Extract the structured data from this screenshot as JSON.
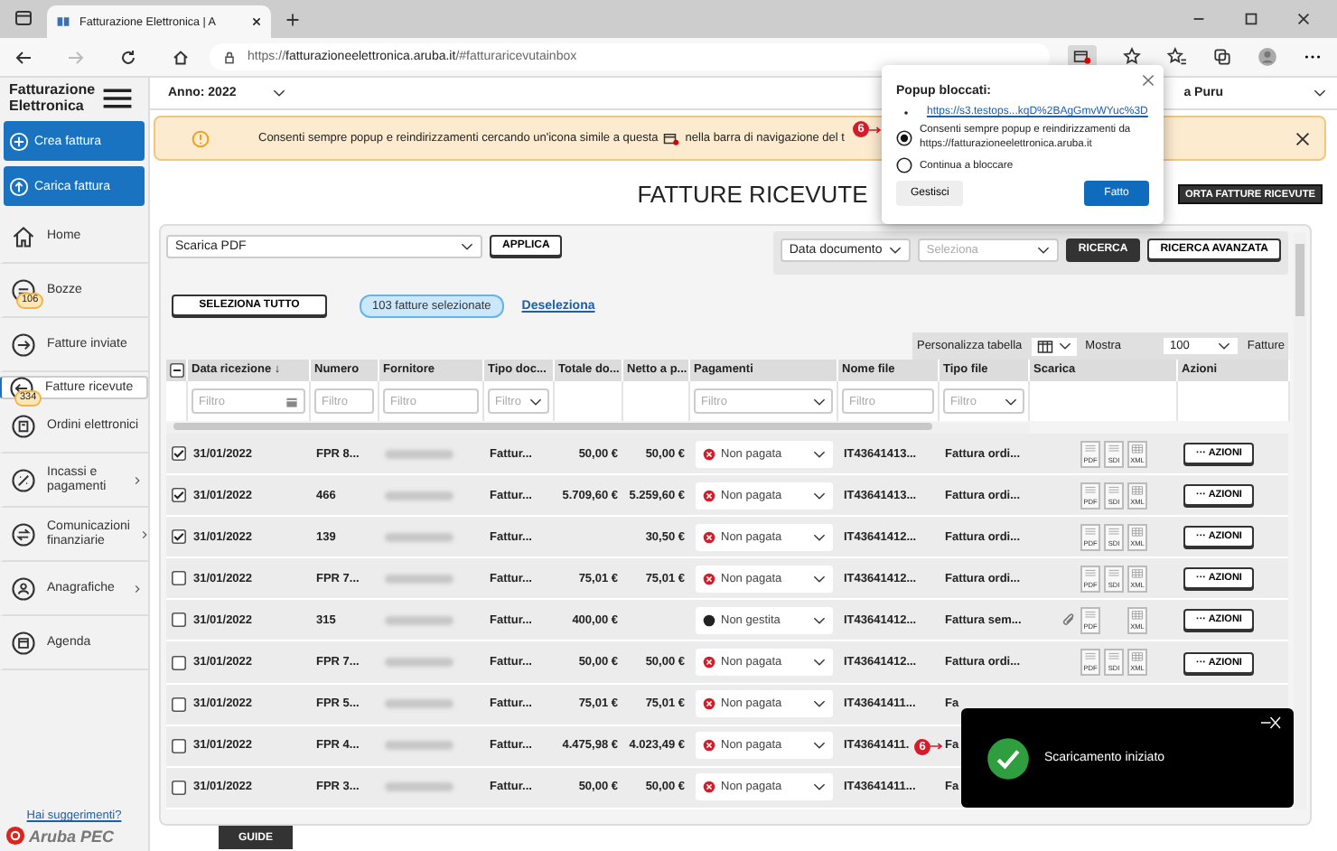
{
  "browser": {
    "tab_title": "Fatturazione Elettronica | A",
    "url_scheme": "https://",
    "url_host": "fatturazioneelettronica.aruba.it",
    "url_path": "/#fatturaricevutainbox"
  },
  "app": {
    "logo": "Fatturazione Elettronica",
    "year_select": "Anno: 2022",
    "user": "a Puru"
  },
  "sidebar": {
    "actions": [
      {
        "label": "Crea fattura",
        "kind": "create"
      },
      {
        "label": "Carica fattura",
        "kind": "upload"
      }
    ],
    "items": [
      {
        "label": "Home",
        "kind": "home",
        "selected": false
      },
      {
        "label": "Bozze",
        "kind": "drafts",
        "badge": "106",
        "selected": false
      },
      {
        "label": "Fatture inviate",
        "kind": "sent",
        "selected": false
      },
      {
        "label": "Fatture ricevute",
        "kind": "received",
        "badge": "334",
        "selected": true
      },
      {
        "label": "Ordini elettronici",
        "kind": "orders",
        "selected": false
      },
      {
        "label": "Incassi e pagamenti",
        "kind": "payments",
        "submenu": true,
        "selected": false
      },
      {
        "label": "Comunicazioni finanziarie",
        "kind": "comms",
        "submenu": true,
        "selected": false
      },
      {
        "label": "Anagrafiche",
        "kind": "registry",
        "submenu": true,
        "selected": false
      },
      {
        "label": "Agenda",
        "kind": "agenda",
        "selected": false
      }
    ],
    "suggestion_link": "Hai suggerimenti?",
    "brand": "Aruba PEC"
  },
  "banner": {
    "text_before": "Consenti sempre popup e reindirizzamenti cercando un'icona simile a questa",
    "text_after": "nella barra di navigazione del t",
    "marker": "6"
  },
  "page": {
    "title": "FATTURE RICEVUTE",
    "export_button": "ORTA FATTURE RICEVUTE"
  },
  "toolbar": {
    "bulk_action": "Scarica PDF",
    "apply": "APPLICA",
    "date_filter": "Data documento",
    "select_placeholder": "Seleziona",
    "search": "RICERCA",
    "advanced_search": "RICERCA AVANZATA",
    "select_all": "SELEZIONA TUTTO",
    "selection_count": "103 fatture selezionate",
    "deselect": "Deseleziona",
    "customize": "Personalizza tabella",
    "show": "Mostra",
    "page_size": "100",
    "page_size_unit": "Fatture"
  },
  "table": {
    "select_all_partial": true,
    "columns": [
      {
        "label": "Data ricezione ↓",
        "filter": {
          "kind": "date",
          "placeholder": "Filtro"
        }
      },
      {
        "label": "Numero",
        "filter": {
          "kind": "text",
          "placeholder": "Filtro"
        }
      },
      {
        "label": "Fornitore",
        "filter": {
          "kind": "text",
          "placeholder": "Filtro"
        }
      },
      {
        "label": "Tipo doc...",
        "filter": {
          "kind": "select",
          "placeholder": "Filtro"
        }
      },
      {
        "label": "Totale do..."
      },
      {
        "label": "Netto a p..."
      },
      {
        "label": "Pagamenti",
        "filter": {
          "kind": "select",
          "placeholder": "Filtro"
        }
      },
      {
        "label": "Nome file",
        "filter": {
          "kind": "text",
          "placeholder": "Filtro"
        }
      },
      {
        "label": "Tipo file",
        "filter": {
          "kind": "select",
          "placeholder": "Filtro"
        }
      },
      {
        "label": "Scarica"
      },
      {
        "label": "Azioni"
      }
    ],
    "rows": [
      {
        "checked": true,
        "date": "31/01/2022",
        "number": "FPR 8...",
        "doc_type": "Fattur...",
        "total": "50,00 €",
        "net": "50,00 €",
        "payment": {
          "kind": "unpaid",
          "label": "Non pagata"
        },
        "file_name": "IT43641413...",
        "file_type": "Fattura ordi...",
        "attachment": false,
        "files": [
          {
            "kind": "doc",
            "label": "PDF"
          },
          {
            "kind": "doc",
            "label": "SDI"
          },
          {
            "kind": "sheet",
            "label": "XML"
          }
        ],
        "actions": "··· AZIONI"
      },
      {
        "checked": true,
        "date": "31/01/2022",
        "number": "466",
        "doc_type": "Fattur...",
        "total": "5.709,60 €",
        "net": "5.259,60 €",
        "payment": {
          "kind": "unpaid",
          "label": "Non pagata"
        },
        "file_name": "IT43641413...",
        "file_type": "Fattura ordi...",
        "attachment": false,
        "files": [
          {
            "kind": "doc",
            "label": "PDF"
          },
          {
            "kind": "doc",
            "label": "SDI"
          },
          {
            "kind": "sheet",
            "label": "XML"
          }
        ],
        "actions": "··· AZIONI"
      },
      {
        "checked": true,
        "date": "31/01/2022",
        "number": "139",
        "doc_type": "Fattur...",
        "net": "30,50 €",
        "payment": {
          "kind": "unpaid",
          "label": "Non pagata"
        },
        "file_name": "IT43641412...",
        "file_type": "Fattura ordi...",
        "attachment": false,
        "files": [
          {
            "kind": "doc",
            "label": "PDF"
          },
          {
            "kind": "doc",
            "label": "SDI"
          },
          {
            "kind": "sheet",
            "label": "XML"
          }
        ],
        "actions": "··· AZIONI"
      },
      {
        "checked": false,
        "date": "31/01/2022",
        "number": "FPR 7...",
        "doc_type": "Fattur...",
        "total": "75,01 €",
        "net": "75,01 €",
        "payment": {
          "kind": "unpaid",
          "label": "Non pagata"
        },
        "file_name": "IT43641412...",
        "file_type": "Fattura ordi...",
        "attachment": false,
        "files": [
          {
            "kind": "doc",
            "label": "PDF"
          },
          {
            "kind": "doc",
            "label": "SDI"
          },
          {
            "kind": "sheet",
            "label": "XML"
          }
        ],
        "actions": "··· AZIONI"
      },
      {
        "checked": false,
        "date": "31/01/2022",
        "number": "315",
        "doc_type": "Fattur...",
        "total": "400,00 €",
        "payment": {
          "kind": "unmanaged",
          "label": "Non gestita"
        },
        "file_name": "IT43641412...",
        "file_type": "Fattura sem...",
        "attachment": true,
        "files": [
          {
            "kind": "doc",
            "label": "PDF"
          },
          {
            "kind": "gap"
          },
          {
            "kind": "sheet",
            "label": "XML"
          }
        ],
        "actions": "··· AZIONI"
      },
      {
        "checked": false,
        "date": "31/01/2022",
        "number": "FPR 7...",
        "doc_type": "Fattur...",
        "total": "50,00 €",
        "net": "50,00 €",
        "payment": {
          "kind": "unpaid",
          "label": "Non pagata"
        },
        "file_name": "IT43641412...",
        "file_type": "Fattura ordi...",
        "attachment": false,
        "files": [
          {
            "kind": "doc",
            "label": "PDF"
          },
          {
            "kind": "doc",
            "label": "SDI"
          },
          {
            "kind": "sheet",
            "label": "XML"
          }
        ],
        "actions": "··· AZIONI"
      },
      {
        "checked": false,
        "date": "31/01/2022",
        "number": "FPR 5...",
        "doc_type": "Fattur...",
        "total": "75,01 €",
        "net": "75,01 €",
        "payment": {
          "kind": "unpaid",
          "label": "Non pagata"
        },
        "file_name": "IT43641411...",
        "file_type": "Fa"
      },
      {
        "checked": false,
        "date": "31/01/2022",
        "number": "FPR 4...",
        "doc_type": "Fattur...",
        "total": "4.475,98 €",
        "net": "4.023,49 €",
        "payment": {
          "kind": "unpaid",
          "label": "Non pagata"
        },
        "file_name": "IT43641411.",
        "marker": "6",
        "file_type": "Fa"
      },
      {
        "checked": false,
        "date": "31/01/2022",
        "number": "FPR 3...",
        "doc_type": "Fattur...",
        "total": "50,00 €",
        "net": "50,00 €",
        "payment": {
          "kind": "unpaid",
          "label": "Non pagata"
        },
        "file_name": "IT43641411...",
        "file_type": "Fa"
      }
    ]
  },
  "guide_tab": "GUIDE",
  "popup": {
    "title": "Popup bloccati:",
    "link": "https://s3.testops...kqD%2BAgGmvWYuc%3D",
    "options": [
      {
        "label": "Consenti sempre popup e reindirizzamenti da https://fatturazioneelettronica.aruba.it",
        "selected": true
      },
      {
        "label": "Continua a bloccare",
        "selected": false
      }
    ],
    "manage": "Gestisci",
    "done": "Fatto"
  },
  "toast": {
    "message": "Scaricamento iniziato"
  }
}
